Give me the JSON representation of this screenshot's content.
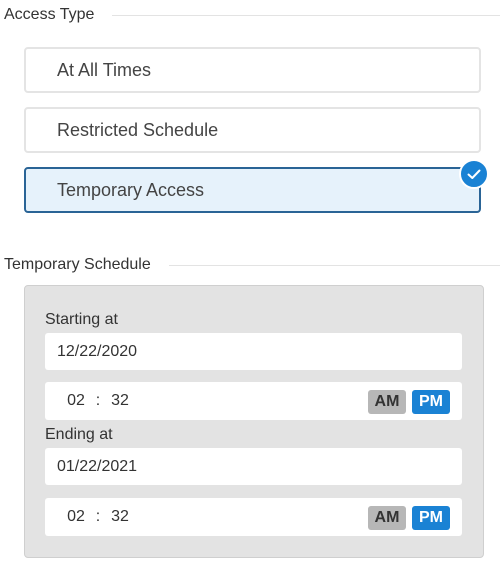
{
  "access_type": {
    "title": "Access Type",
    "options": [
      {
        "label": "At All Times",
        "selected": false
      },
      {
        "label": "Restricted Schedule",
        "selected": false
      },
      {
        "label": "Temporary Access",
        "selected": true
      }
    ]
  },
  "temporary_schedule": {
    "title": "Temporary Schedule",
    "start": {
      "label": "Starting at",
      "date": "12/22/2020",
      "hour": "02",
      "separator": ":",
      "minute": "32",
      "am_label": "AM",
      "pm_label": "PM",
      "period": "PM"
    },
    "end": {
      "label": "Ending at",
      "date": "01/22/2021",
      "hour": "02",
      "separator": ":",
      "minute": "32",
      "am_label": "AM",
      "pm_label": "PM",
      "period": "PM"
    }
  },
  "colors": {
    "accent": "#1a82d4",
    "selected_bg": "#e6f2fb",
    "selected_border": "#2a6496",
    "panel_bg": "#e3e3e3"
  },
  "icons": {
    "selected_badge": "checkmark-icon"
  }
}
